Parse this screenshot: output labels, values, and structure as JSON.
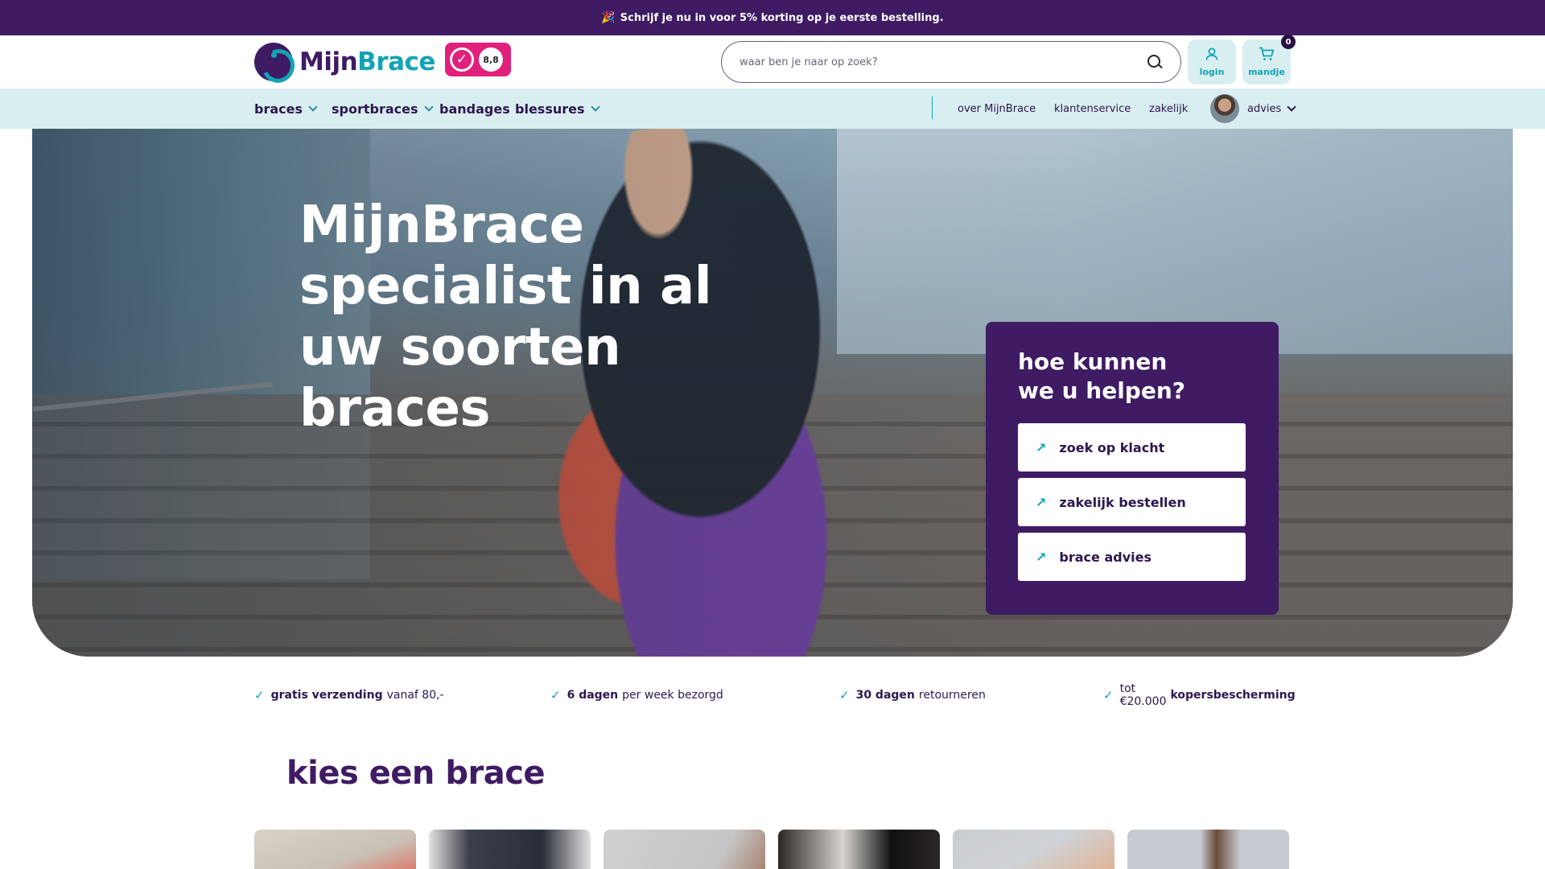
{
  "promo": {
    "emoji": "🎉",
    "text": "Schrijf je nu in voor 5% korting op je eerste bestelling."
  },
  "header": {
    "logo_part1": "Mijn",
    "logo_part2": "Brace",
    "rating": "8,8",
    "search_placeholder": "waar ben je naar op zoek?",
    "login_label": "login",
    "cart_label": "mandje",
    "cart_count": "0"
  },
  "nav": {
    "items": [
      {
        "label": "braces"
      },
      {
        "label": "sportbraces"
      },
      {
        "label": "bandages"
      },
      {
        "label": "blessures"
      }
    ],
    "links": [
      {
        "label": "over MijnBrace"
      },
      {
        "label": "klantenservice"
      },
      {
        "label": "zakelijk"
      }
    ],
    "advies_label": "advies"
  },
  "hero": {
    "title": "MijnBrace specialist in al uw soorten braces",
    "help_title_line1": "hoe kunnen",
    "help_title_line2": "we u helpen?",
    "help_buttons": [
      {
        "label": "zoek op klacht"
      },
      {
        "label": "zakelijk bestellen"
      },
      {
        "label": "brace advies"
      }
    ]
  },
  "usps": [
    {
      "bold": "gratis verzending",
      "text": "vanaf 80,-"
    },
    {
      "bold": "6 dagen",
      "text": "per week bezorgd"
    },
    {
      "bold": "30 dagen",
      "text": "retourneren"
    },
    {
      "pre": "tot €20.000",
      "bold": "kopersbescherming"
    }
  ],
  "section": {
    "title": "kies een brace"
  },
  "colors": {
    "primary": "#3e1b63",
    "accent": "#12a4b5",
    "nav_bg": "#d9eef0",
    "rating_badge": "#e0207a"
  },
  "icons": [
    "search-icon",
    "user-icon",
    "cart-icon",
    "chevron-down-icon",
    "arrow-up-right-icon",
    "check-icon"
  ]
}
